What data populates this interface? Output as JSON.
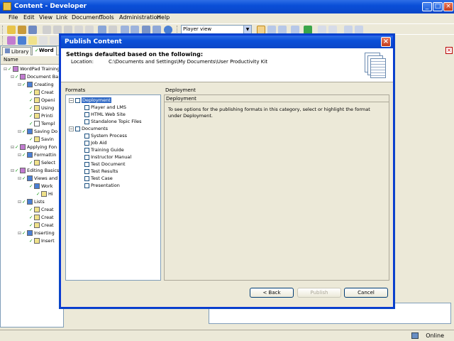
{
  "window": {
    "title": "Content - Developer"
  },
  "menu": [
    "File",
    "Edit",
    "View",
    "Link",
    "Document",
    "Tools",
    "Administration",
    "Help"
  ],
  "toolbar": {
    "view_select": "Player view"
  },
  "library": {
    "tabs": [
      "Library",
      "Word"
    ],
    "column_header": "Name",
    "tree": [
      {
        "label": "WordPad Training",
        "icon": "module",
        "indent": 0
      },
      {
        "label": "Document Ba",
        "icon": "module",
        "indent": 1
      },
      {
        "label": "Creating",
        "icon": "section",
        "indent": 2
      },
      {
        "label": "Creat",
        "icon": "topic",
        "indent": 3
      },
      {
        "label": "Openi",
        "icon": "topic",
        "indent": 3
      },
      {
        "label": "Using",
        "icon": "topic",
        "indent": 3
      },
      {
        "label": "Printi",
        "icon": "topic",
        "indent": 3
      },
      {
        "label": "Templ",
        "icon": "doc",
        "indent": 3
      },
      {
        "label": "Saving Do",
        "icon": "section",
        "indent": 2
      },
      {
        "label": "Savin",
        "icon": "topic",
        "indent": 3
      },
      {
        "label": "Applying Fon",
        "icon": "module",
        "indent": 1
      },
      {
        "label": "Formattin",
        "icon": "section",
        "indent": 2
      },
      {
        "label": "Select",
        "icon": "topic",
        "indent": 3
      },
      {
        "label": "Editing Basics",
        "icon": "module",
        "indent": 1
      },
      {
        "label": "Views and",
        "icon": "section",
        "indent": 2
      },
      {
        "label": "Work",
        "icon": "section",
        "indent": 3
      },
      {
        "label": "Hi",
        "icon": "topic",
        "indent": 4
      },
      {
        "label": "Lists",
        "icon": "section",
        "indent": 2
      },
      {
        "label": "Creat",
        "icon": "topic",
        "indent": 3
      },
      {
        "label": "Creat",
        "icon": "topic",
        "indent": 3
      },
      {
        "label": "Creat",
        "icon": "topic",
        "indent": 3
      },
      {
        "label": "Inserting",
        "icon": "section",
        "indent": 2
      },
      {
        "label": "Insert",
        "icon": "topic",
        "indent": 3
      }
    ]
  },
  "dialog": {
    "title": "Publish Content",
    "heading": "Settings defaulted based on the following:",
    "location_label": "Location:",
    "location_value": "C:\\Documents and Settings\\My Documents\\User Productivity Kit",
    "formats_label": "Formats",
    "formats": [
      {
        "label": "Deployment",
        "level": 0,
        "expander": true,
        "selected": true
      },
      {
        "label": "Player and LMS",
        "level": 1
      },
      {
        "label": "HTML Web Site",
        "level": 1
      },
      {
        "label": "Standalone Topic Files",
        "level": 1
      },
      {
        "label": "Documents",
        "level": 0,
        "expander": true
      },
      {
        "label": "System Process",
        "level": 1
      },
      {
        "label": "Job Aid",
        "level": 1
      },
      {
        "label": "Training Guide",
        "level": 1
      },
      {
        "label": "Instructor Manual",
        "level": 1
      },
      {
        "label": "Test Document",
        "level": 1
      },
      {
        "label": "Test Results",
        "level": 1
      },
      {
        "label": "Test Case",
        "level": 1
      },
      {
        "label": "Presentation",
        "level": 1
      }
    ],
    "description_label": "Deployment",
    "description_title": "Deployment",
    "description_text": "To see options for the publishing formats in this category, select or highlight the format under Deployment.",
    "buttons": {
      "back": "< Back",
      "publish": "Publish",
      "cancel": "Cancel"
    }
  },
  "status": {
    "online": "Online"
  }
}
